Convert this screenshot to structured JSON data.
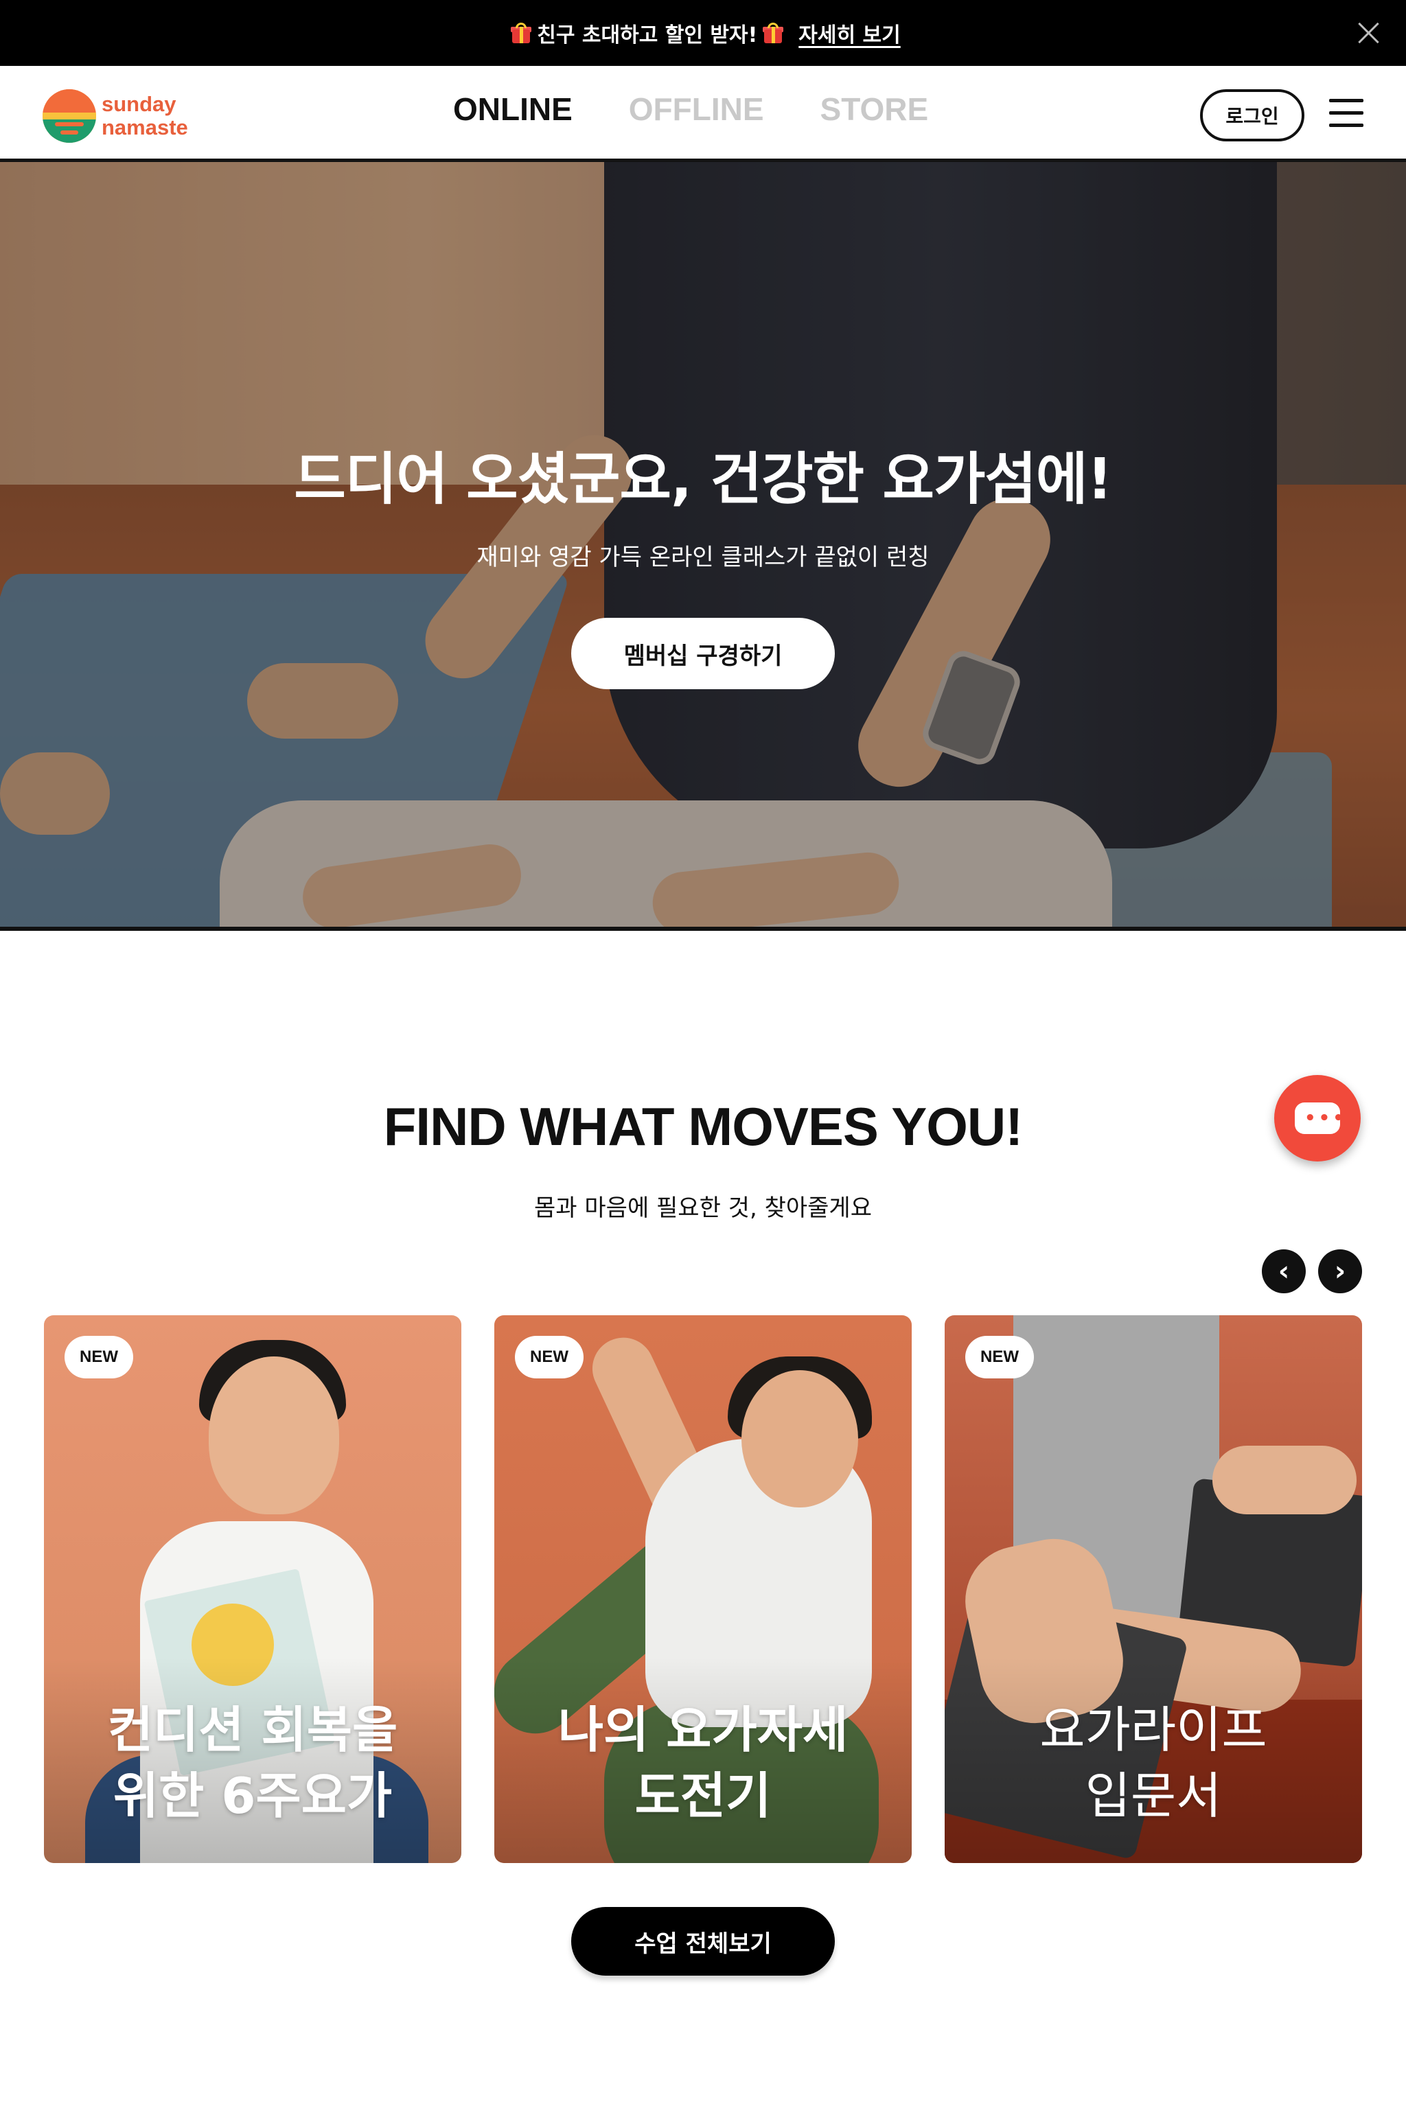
{
  "announcement": {
    "text": "친구 초대하고 할인 받자!",
    "link": "자세히 보기",
    "gift_icon": "gift-icon",
    "close_icon": "close-icon"
  },
  "header": {
    "logo_line1": "sunday",
    "logo_line2": "namaste",
    "nav": [
      "ONLINE",
      "OFFLINE",
      "STORE"
    ],
    "active_nav": "ONLINE",
    "login_label": "로그인",
    "menu_icon": "hamburger-menu-icon"
  },
  "hero": {
    "title": "드디어 오셨군요, 건강한 요가섬에!",
    "subtitle": "재미와 영감 가득 온라인 클래스가 끝없이 런칭",
    "cta_label": "멤버십 구경하기"
  },
  "section": {
    "title": "FIND WHAT MOVES YOU!",
    "subtitle": "몸과 마음에 필요한 것, 찾아줄게요",
    "prev_label": "‹",
    "next_label": "›",
    "chat_icon": "chat-icon"
  },
  "cards": [
    {
      "badge": "NEW",
      "title_line1": "컨디션 회복을",
      "title_line2": "위한 6주요가"
    },
    {
      "badge": "NEW",
      "title_line1": "나의 요가자세",
      "title_line2": "도전기"
    },
    {
      "badge": "NEW",
      "title_line1": "요가라이프",
      "title_line2": "입문서"
    }
  ],
  "all_classes_label": "수업 전체보기",
  "colors": {
    "brand_orange": "#e8603c",
    "chat_red": "#f14a3b",
    "nav_inactive": "#c9c9c9"
  }
}
